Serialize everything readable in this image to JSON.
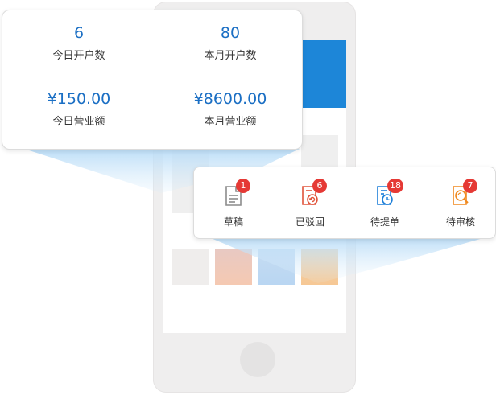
{
  "stats": [
    {
      "value": "6",
      "label": "今日开户数"
    },
    {
      "value": "80",
      "label": "本月开户数"
    },
    {
      "value": "¥150.00",
      "label": "今日营业额"
    },
    {
      "value": "¥8600.00",
      "label": "本月营业额"
    }
  ],
  "actions": [
    {
      "label": "草稿",
      "badge": "1",
      "icon": "draft-icon",
      "color": "#8c8c8c"
    },
    {
      "label": "已驳回",
      "badge": "6",
      "icon": "rejected-icon",
      "color": "#e0533a"
    },
    {
      "label": "待提单",
      "badge": "18",
      "icon": "pending-submit-icon",
      "color": "#1d7fd8"
    },
    {
      "label": "待审核",
      "badge": "7",
      "icon": "pending-review-icon",
      "color": "#f0891f"
    }
  ],
  "colors": {
    "accent": "#1b6fc4",
    "banner": "#1d86d8",
    "badge": "#e53935"
  }
}
